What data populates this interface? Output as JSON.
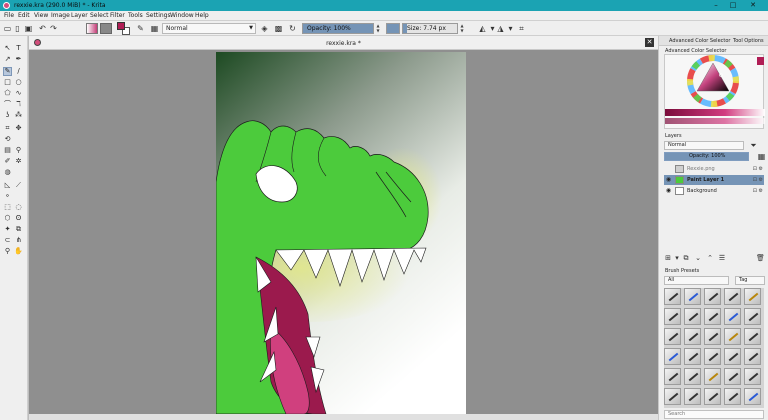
{
  "window": {
    "title": "rexxie.kra (290.0 MiB)  * - Krita",
    "controls": {
      "minimize": "–",
      "maximize": "□",
      "close": "✕"
    }
  },
  "menu": [
    "File",
    "Edit",
    "View",
    "Image",
    "Layer",
    "Select",
    "Filter",
    "Tools",
    "Settings",
    "Window",
    "Help"
  ],
  "toolbar": {
    "blend_mode": "Normal",
    "opacity_label": "Opacity: 100%",
    "opacity_value": 1.0,
    "size_label": "Size: 7.74 px",
    "size_value": 0.08,
    "icons": [
      "new-document-icon",
      "open-icon",
      "save-icon",
      "undo-icon",
      "redo-icon",
      "eraser-icon",
      "alpha-lock-icon",
      "reload-icon",
      "mirror-horizontal-icon",
      "mirror-vertical-icon",
      "wrap-icon"
    ]
  },
  "canvas": {
    "doc_title": "rexxie.kra *",
    "close_glyph": "✕"
  },
  "docker": {
    "tabs": [
      "Advanced Color Selector",
      "Tool Options"
    ],
    "color_panel_title": "Advanced Color Selector",
    "layers_title": "Layers",
    "layer_blend_mode": "Normal",
    "layer_opacity_label": "Opacity: 100%",
    "layers": [
      {
        "name": "Rexxie.png",
        "visible": false,
        "selected": false,
        "thumb_color": "#cfcfcf"
      },
      {
        "name": "Paint Layer 1",
        "visible": true,
        "selected": true,
        "thumb_color": "#4ccb3c"
      },
      {
        "name": "Background",
        "visible": true,
        "selected": false,
        "thumb_color": "#ffffff"
      }
    ],
    "presets_title": "Brush Presets",
    "preset_filter": "All",
    "preset_tag": "Tag",
    "search_placeholder": "Search"
  },
  "colors": {
    "accent": "#1ba3b3",
    "selection": "#7594b6",
    "dino_green": "#4ccb3c",
    "mouth": "#9b1a4d",
    "tongue": "#d0407e",
    "foreground": "#b01d55",
    "background_swatch": "#ffffff"
  }
}
